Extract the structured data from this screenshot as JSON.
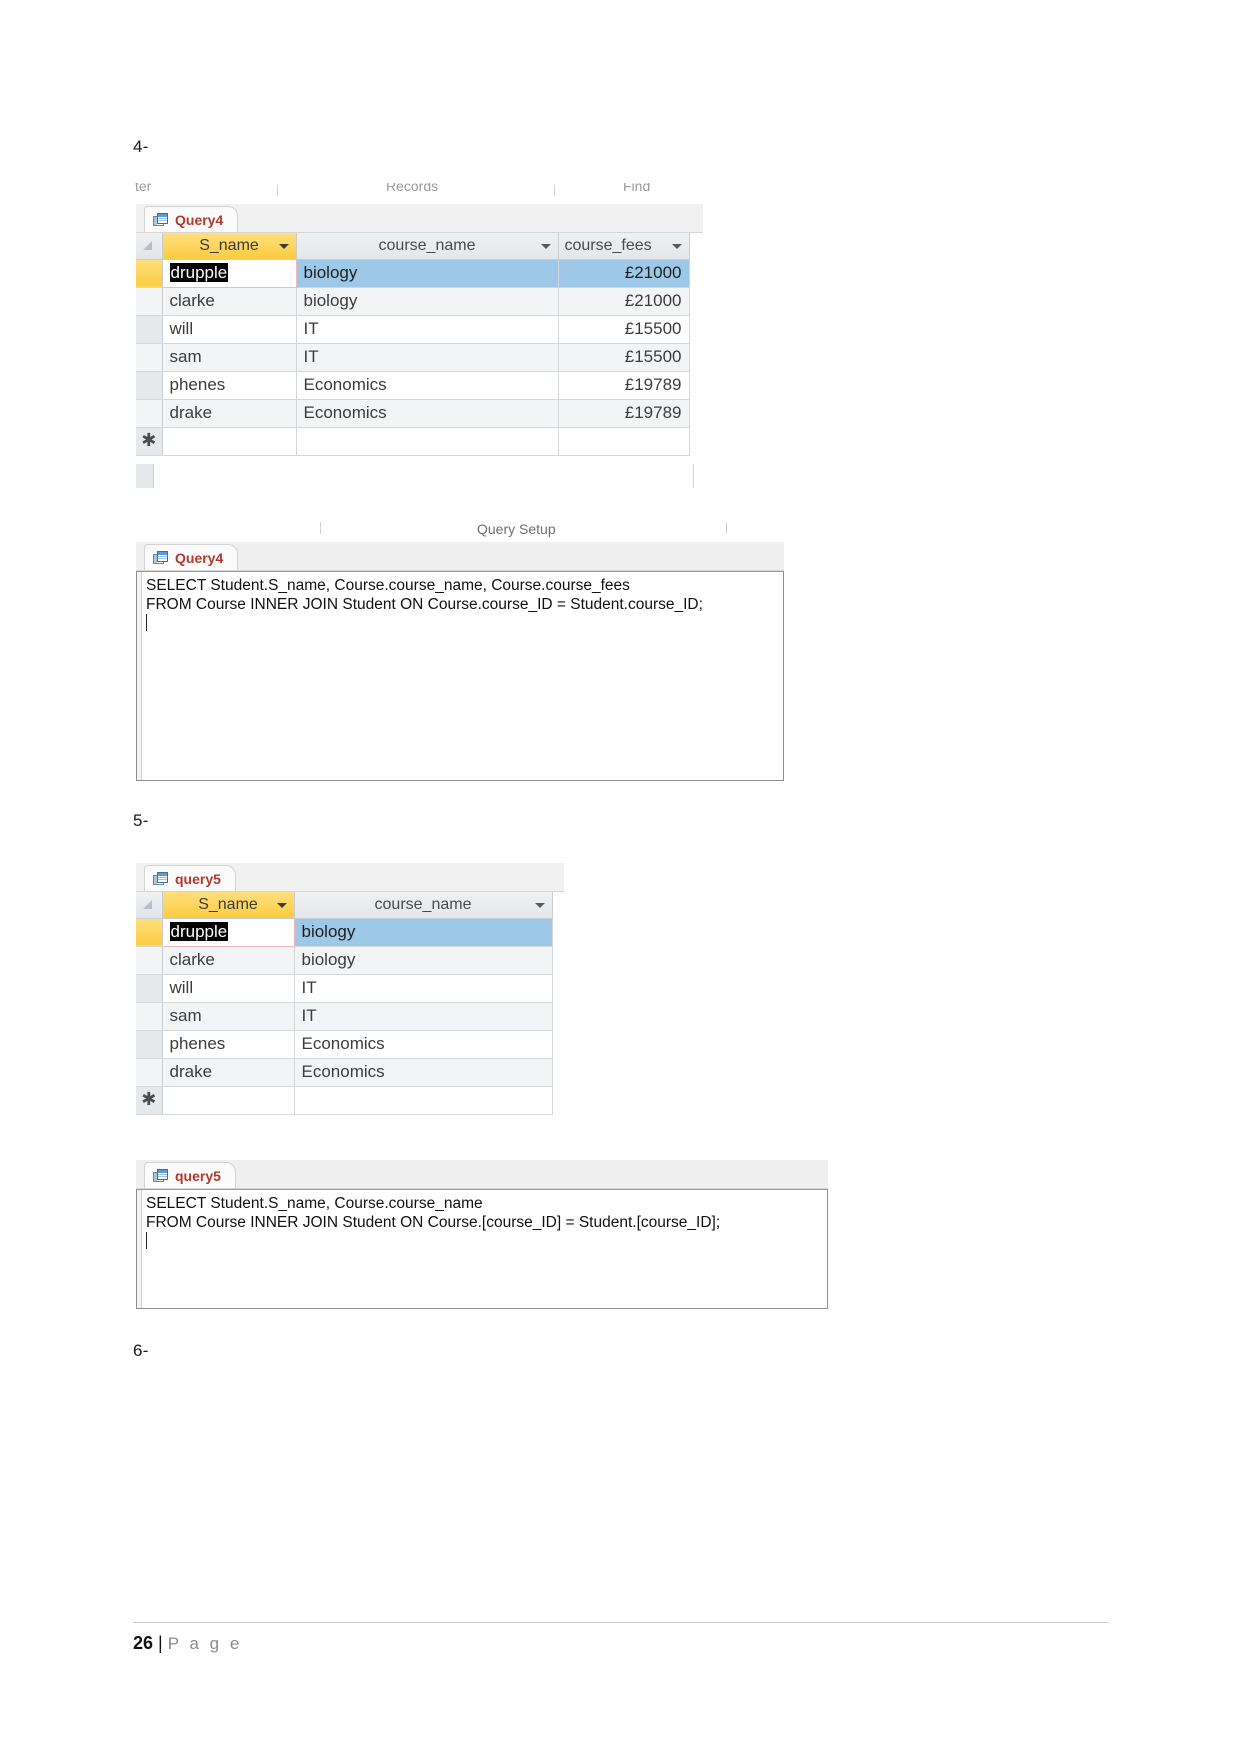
{
  "document": {
    "footer": {
      "page_number": "26",
      "separator": "|",
      "page_word": "P a g e"
    }
  },
  "steps": {
    "four": "4-",
    "five": "5-",
    "six": "6-"
  },
  "screenshot_4": {
    "ribbon_fragments": {
      "sort_filter": "ter",
      "records": "Records",
      "find": "Find"
    },
    "datasheet": {
      "tab_label": "Query4",
      "tab_icon": "query-datasheet-icon",
      "columns": [
        {
          "key": "s_name",
          "label": "S_name",
          "selected": true,
          "align": "center",
          "caret": true
        },
        {
          "key": "course_name",
          "label": "course_name",
          "selected": false,
          "align": "center",
          "caret": true
        },
        {
          "key": "course_fees",
          "label": "course_fees",
          "selected": false,
          "align": "left",
          "caret": true
        }
      ],
      "rows": [
        {
          "s_name": "drupple",
          "course_name": "biology",
          "course_fees": "£21000",
          "current": true,
          "editing": true
        },
        {
          "s_name": "clarke",
          "course_name": "biology",
          "course_fees": "£21000",
          "current": false,
          "editing": false
        },
        {
          "s_name": "will",
          "course_name": "IT",
          "course_fees": "£15500",
          "current": false,
          "editing": false
        },
        {
          "s_name": "sam",
          "course_name": "IT",
          "course_fees": "£15500",
          "current": false,
          "editing": false
        },
        {
          "s_name": "phenes",
          "course_name": "Economics",
          "course_fees": "£19789",
          "current": false,
          "editing": false
        },
        {
          "s_name": "drake",
          "course_name": "Economics",
          "course_fees": "£19789",
          "current": false,
          "editing": false
        }
      ],
      "new_record_marker": "✱"
    },
    "sql_view": {
      "group_label": "Query Setup",
      "tab_label": "Query4",
      "tab_icon": "query-design-icon",
      "sql": "SELECT Student.S_name, Course.course_name, Course.course_fees\nFROM Course INNER JOIN Student ON Course.course_ID = Student.course_ID;"
    }
  },
  "screenshot_5": {
    "datasheet": {
      "tab_label": "query5",
      "tab_icon": "query-datasheet-icon",
      "columns": [
        {
          "key": "s_name",
          "label": "S_name",
          "selected": true,
          "align": "center",
          "caret": true
        },
        {
          "key": "course_name",
          "label": "course_name",
          "selected": false,
          "align": "center",
          "caret": true
        }
      ],
      "rows": [
        {
          "s_name": "drupple",
          "course_name": "biology",
          "current": true,
          "editing": true
        },
        {
          "s_name": "clarke",
          "course_name": "biology",
          "current": false,
          "editing": false
        },
        {
          "s_name": "will",
          "course_name": "IT",
          "current": false,
          "editing": false
        },
        {
          "s_name": "sam",
          "course_name": "IT",
          "current": false,
          "editing": false
        },
        {
          "s_name": "phenes",
          "course_name": "Economics",
          "current": false,
          "editing": false
        },
        {
          "s_name": "drake",
          "course_name": "Economics",
          "current": false,
          "editing": false
        }
      ],
      "new_record_marker": "✱"
    },
    "sql_view": {
      "group_label": "",
      "tab_label": "query5",
      "tab_icon": "query-design-icon",
      "sql": "SELECT Student.S_name, Course.course_name\nFROM Course INNER JOIN Student ON Course.[course_ID] = Student.[course_ID];"
    }
  },
  "colors": {
    "tab_text": "#b03a2e",
    "selected_column_header": "#fccc3f",
    "current_row_highlight": "#9dc8e8",
    "editing_cell_border": "#f2b9bd",
    "selection_text_bg": "#000000"
  }
}
